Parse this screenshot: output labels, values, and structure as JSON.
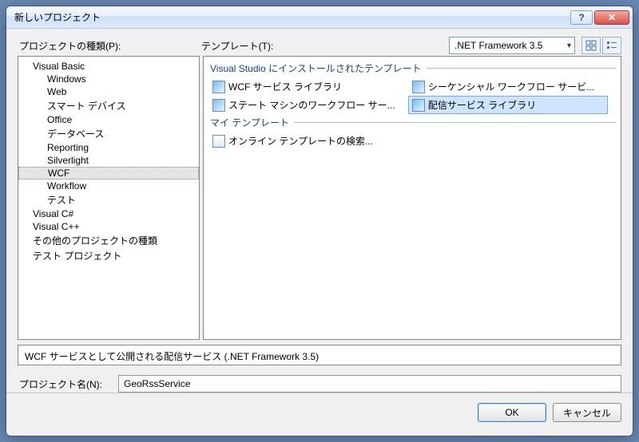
{
  "window": {
    "title": "新しいプロジェクト"
  },
  "labels": {
    "projectTypes": "プロジェクトの種類(P):",
    "templates": "テンプレート(T):",
    "projectName": "プロジェクト名(N):"
  },
  "framework": {
    "selected": ".NET Framework 3.5"
  },
  "tree": {
    "items": [
      {
        "label": "Visual Basic",
        "level": 0
      },
      {
        "label": "Windows",
        "level": 1
      },
      {
        "label": "Web",
        "level": 1
      },
      {
        "label": "スマート デバイス",
        "level": 1
      },
      {
        "label": "Office",
        "level": 1
      },
      {
        "label": "データベース",
        "level": 1
      },
      {
        "label": "Reporting",
        "level": 1
      },
      {
        "label": "Silverlight",
        "level": 1
      },
      {
        "label": "WCF",
        "level": 1,
        "selected": true
      },
      {
        "label": "Workflow",
        "level": 1
      },
      {
        "label": "テスト",
        "level": 1
      },
      {
        "label": "Visual C#",
        "level": 0
      },
      {
        "label": "Visual C++",
        "level": 0
      },
      {
        "label": "その他のプロジェクトの種類",
        "level": 0
      },
      {
        "label": "テスト プロジェクト",
        "level": 0
      }
    ]
  },
  "templateGroups": {
    "installed": {
      "header": "Visual Studio にインストールされたテンプレート",
      "items": [
        {
          "label": "WCF サービス ライブラリ"
        },
        {
          "label": "シーケンシャル ワークフロー サービ..."
        },
        {
          "label": "ステート マシンのワークフロー サー..."
        },
        {
          "label": "配信サービス ライブラリ",
          "selected": true
        }
      ]
    },
    "my": {
      "header": "マイ テンプレート",
      "items": [
        {
          "label": "オンライン テンプレートの検索...",
          "search": true
        }
      ]
    }
  },
  "description": "WCF サービスとして公開される配信サービス (.NET Framework 3.5)",
  "projectName": "GeoRssService",
  "buttons": {
    "ok": "OK",
    "cancel": "キャンセル"
  }
}
